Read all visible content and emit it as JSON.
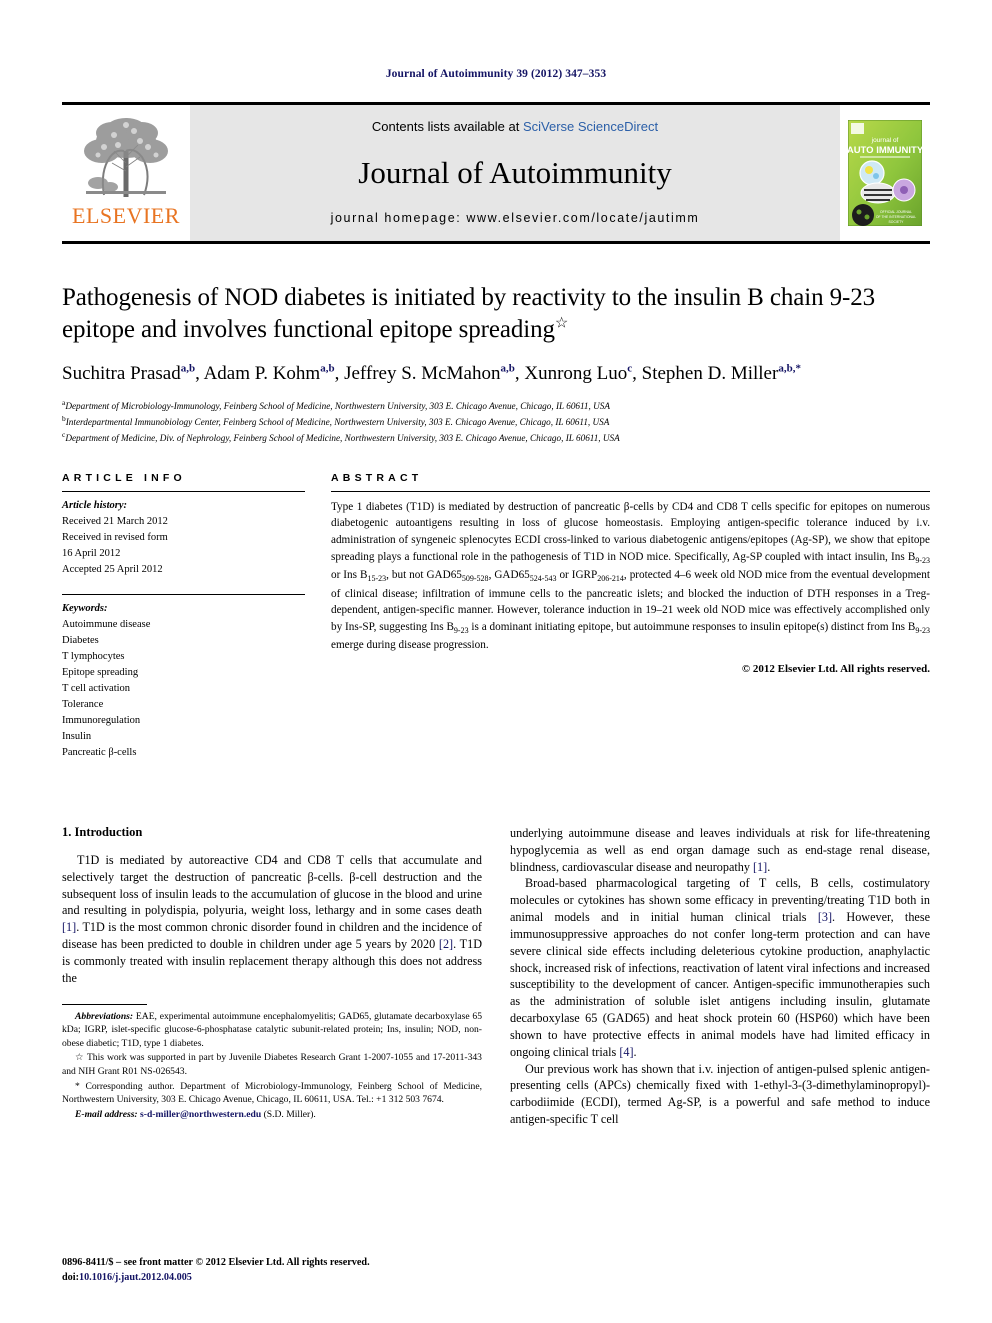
{
  "running_head": "Journal of Autoimmunity 39 (2012) 347–353",
  "masthead": {
    "publisher_name": "ELSEVIER",
    "contents_prefix": "Contents lists available at ",
    "contents_link": "SciVerse ScienceDirect",
    "journal_title": "Journal of Autoimmunity",
    "homepage": "journal homepage: www.elsevier.com/locate/jautimm",
    "cover": {
      "line1": "journal of",
      "line2": "AUTO IMMUNITY"
    }
  },
  "article": {
    "title": "Pathogenesis of NOD diabetes is initiated by reactivity to the insulin B chain 9-23 epitope and involves functional epitope spreading",
    "title_marker": "☆",
    "authors": [
      {
        "name": "Suchitra Prasad",
        "sup": "a,b",
        "sep": ", "
      },
      {
        "name": "Adam P. Kohm",
        "sup": "a,b",
        "sep": ", "
      },
      {
        "name": "Jeffrey S. McMahon",
        "sup": "a,b",
        "sep": ", "
      },
      {
        "name": "Xunrong Luo",
        "sup": "c",
        "sep": ", "
      },
      {
        "name": "Stephen D. Miller",
        "sup": "a,b,*",
        "sep": ""
      }
    ],
    "affiliations": [
      {
        "mark": "a",
        "text": "Department of Microbiology-Immunology, Feinberg School of Medicine, Northwestern University, 303 E. Chicago Avenue, Chicago, IL 60611, USA"
      },
      {
        "mark": "b",
        "text": "Interdepartmental Immunobiology Center, Feinberg School of Medicine, Northwestern University, 303 E. Chicago Avenue, Chicago, IL 60611, USA"
      },
      {
        "mark": "c",
        "text": "Department of Medicine, Div. of Nephrology, Feinberg School of Medicine, Northwestern University, 303 E. Chicago Avenue, Chicago, IL 60611, USA"
      }
    ]
  },
  "article_info": {
    "heading": "ARTICLE INFO",
    "history_label": "Article history:",
    "history": [
      "Received 21 March 2012",
      "Received in revised form",
      "16 April 2012",
      "Accepted 25 April 2012"
    ],
    "keywords_label": "Keywords:",
    "keywords": [
      "Autoimmune disease",
      "Diabetes",
      "T lymphocytes",
      "Epitope spreading",
      "T cell activation",
      "Tolerance",
      "Immunoregulation",
      "Insulin",
      "Pancreatic β-cells"
    ]
  },
  "abstract": {
    "heading": "ABSTRACT",
    "paragraph_parts": [
      {
        "t": "Type 1 diabetes (T1D) is mediated by destruction of pancreatic β-cells by CD4 and CD8 T cells specific for epitopes on numerous diabetogenic autoantigens resulting in loss of glucose homeostasis. Employing antigen-specific tolerance induced by i.v. administration of syngeneic splenocytes ECDI cross-linked to various diabetogenic antigens/epitopes (Ag-SP), we show that epitope spreading plays a functional role in the pathogenesis of T1D in NOD mice. Specifically, Ag-SP coupled with intact insulin, Ins B"
      },
      {
        "sub": "9-23"
      },
      {
        "t": " or Ins B"
      },
      {
        "sub": "15-23"
      },
      {
        "t": ", but not GAD65"
      },
      {
        "sub": "509-528"
      },
      {
        "t": ", GAD65"
      },
      {
        "sub": "524-543"
      },
      {
        "t": " or IGRP"
      },
      {
        "sub": "206-214"
      },
      {
        "t": ", protected 4–6 week old NOD mice from the eventual development of clinical disease; infiltration of immune cells to the pancreatic islets; and blocked the induction of DTH responses in a Treg-dependent, antigen-specific manner. However, tolerance induction in 19–21 week old NOD mice was effectively accomplished only by Ins-SP, suggesting Ins B"
      },
      {
        "sub": "9-23"
      },
      {
        "t": " is a dominant initiating epitope, but autoimmune responses to insulin epitope(s) distinct from Ins B"
      },
      {
        "sub": "9-23"
      },
      {
        "t": " emerge during disease progression."
      }
    ],
    "copyright": "© 2012 Elsevier Ltd. All rights reserved."
  },
  "introduction": {
    "heading": "1. Introduction",
    "left_paragraphs": [
      "T1D is mediated by autoreactive CD4 and CD8 T cells that accumulate and selectively target the destruction of pancreatic β-cells. β-cell destruction and the subsequent loss of insulin leads to the accumulation of glucose in the blood and urine and resulting in polydispia, polyuria, weight loss, lethargy and in some cases death [1]. T1D is the most common chronic disorder found in children and the incidence of disease has been predicted to double in children under age 5 years by 2020 [2]. T1D is commonly treated with insulin replacement therapy although this does not address the"
    ],
    "right_paragraphs": [
      "underlying autoimmune disease and leaves individuals at risk for life-threatening hypoglycemia as well as end organ damage such as end-stage renal disease, blindness, cardiovascular disease and neuropathy [1].",
      "Broad-based pharmacological targeting of T cells, B cells, costimulatory molecules or cytokines has shown some efficacy in preventing/treating T1D both in animal models and in initial human clinical trials [3]. However, these immunosuppressive approaches do not confer long-term protection and can have severe clinical side effects including deleterious cytokine production, anaphylactic shock, increased risk of infections, reactivation of latent viral infections and increased susceptibility to the development of cancer. Antigen-specific immunotherapies such as the administration of soluble islet antigens including insulin, glutamate decarboxylase 65 (GAD65) and heat shock protein 60 (HSP60) which have been shown to have protective effects in animal models have had limited efficacy in ongoing clinical trials [4].",
      "Our previous work has shown that i.v. injection of antigen-pulsed splenic antigen-presenting cells (APCs) chemically fixed with 1-ethyl-3-(3-dimethylaminopropyl)-carbodiimide (ECDI), termed Ag-SP, is a powerful and safe method to induce antigen-specific T cell"
    ]
  },
  "footnotes": {
    "abbreviations_label": "Abbreviations:",
    "abbreviations_text": "EAE, experimental autoimmune encephalomyelitis; GAD65, glutamate decarboxylase 65 kDa; IGRP, islet-specific glucose-6-phosphatase catalytic subunit-related protein; Ins, insulin; NOD, non-obese diabetic; T1D, type 1 diabetes.",
    "funding_marker": "☆",
    "funding_text": "This work was supported in part by Juvenile Diabetes Research Grant 1-2007-1055 and 17-2011-343 and NIH Grant R01 NS-026543.",
    "corresponding_marker": "*",
    "corresponding_text": "Corresponding author. Department of Microbiology-Immunology, Feinberg School of Medicine, Northwestern University, 303 E. Chicago Avenue, Chicago, IL 60611, USA. Tel.: +1 312 503 7674.",
    "email_label": "E-mail address:",
    "email": "s-d-miller@northwestern.edu",
    "email_owner": "(S.D. Miller)."
  },
  "page_footer": {
    "issn_line": "0896-8411/$ – see front matter © 2012 Elsevier Ltd. All rights reserved.",
    "doi_label": "doi:",
    "doi": "10.1016/j.jaut.2012.04.005"
  }
}
